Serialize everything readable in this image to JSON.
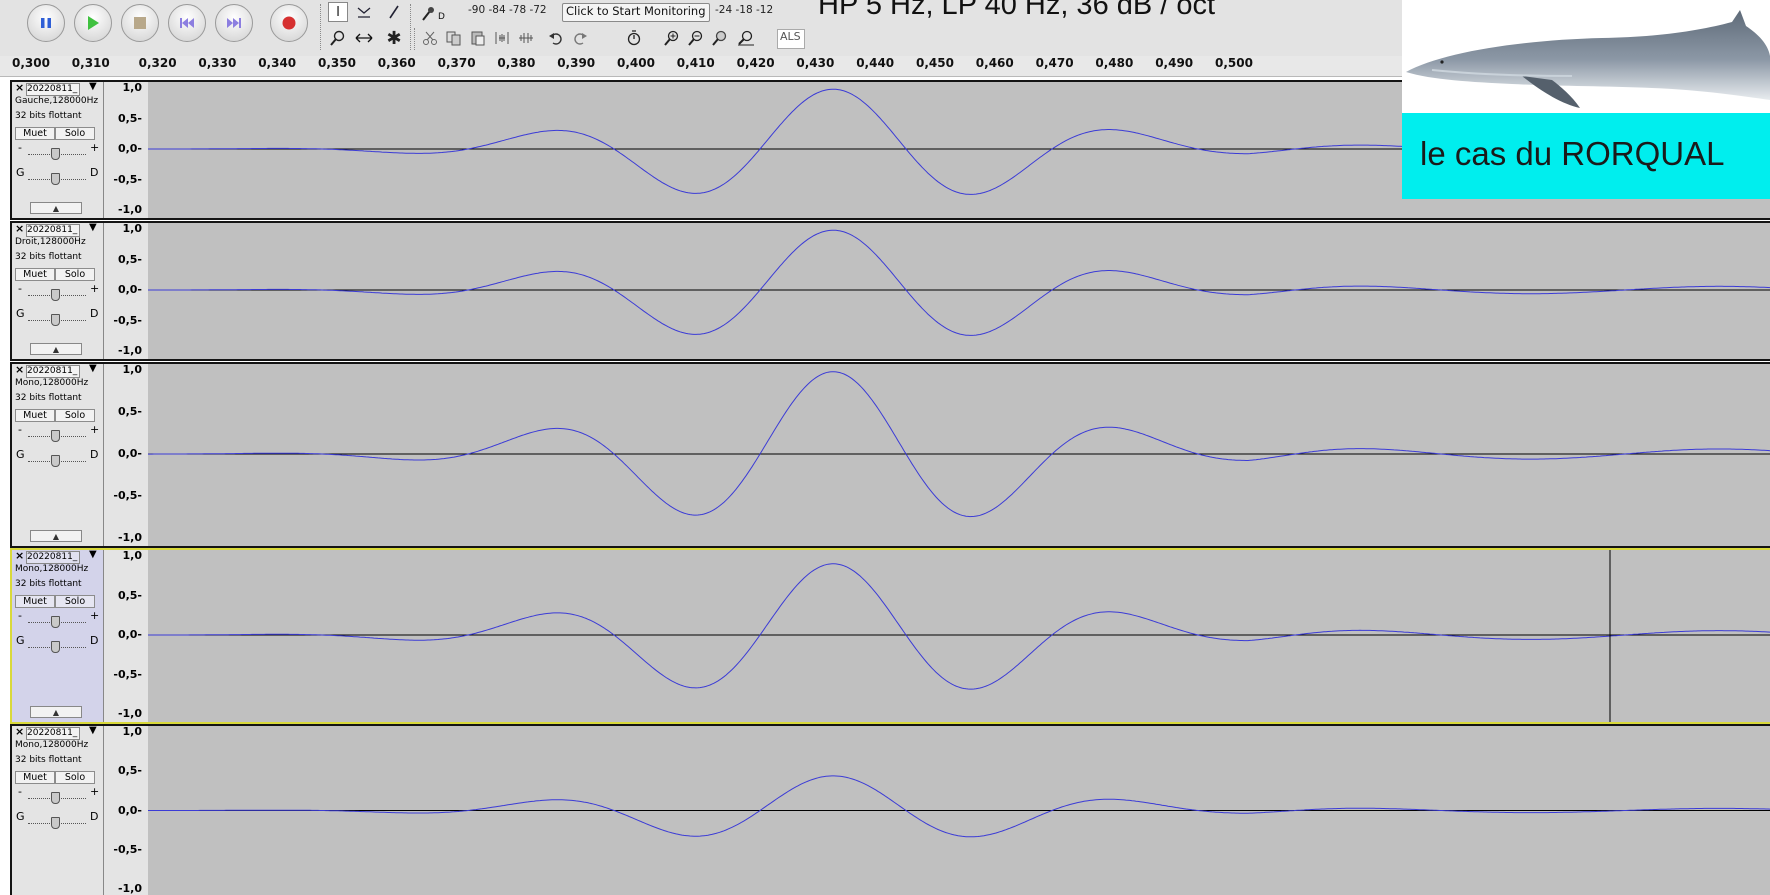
{
  "slide": {
    "title": "HP 5 Hz, LP 40 Hz, 36 dB / oct",
    "caption": "le cas du RORQUAL"
  },
  "toolbar": {
    "buttons": [
      {
        "name": "pause-button",
        "icon": "pause-icon"
      },
      {
        "name": "play-button",
        "icon": "play-icon"
      },
      {
        "name": "stop-button",
        "icon": "stop-icon"
      },
      {
        "name": "skip-start-button",
        "icon": "skip-start-icon"
      },
      {
        "name": "skip-end-button",
        "icon": "skip-end-icon"
      },
      {
        "name": "record-button",
        "icon": "record-icon"
      }
    ],
    "meter_scale_left": "-90 -84 -78 -72",
    "monitor_label": "Click to Start Monitoring",
    "meter_scale_right": "-24 -18 -12",
    "audio_host": "ALS",
    "meter_letter": "D"
  },
  "ruler": {
    "ticks": [
      "0,300",
      "0,310",
      "0,320",
      "0,330",
      "0,340",
      "0,350",
      "0,360",
      "0,370",
      "0,380",
      "0,390",
      "0,400",
      "0,410",
      "0,420",
      "0,430",
      "0,440",
      "0,450",
      "0,460",
      "0,470",
      "0,480",
      "0,490",
      "0,500"
    ]
  },
  "tracks": [
    {
      "name": "20220811_",
      "channel": "Gauche,128000Hz",
      "format": "32 bits flottant",
      "mute": "Muet",
      "solo": "Solo",
      "gain_left": "-",
      "gain_right": "+",
      "pan_left": "G",
      "pan_right": "D",
      "scale": [
        "1,0",
        "0,5-",
        "0,0-",
        "-0,5-",
        "-1,0"
      ],
      "selected": false
    },
    {
      "name": "20220811_",
      "channel": "Droit,128000Hz",
      "format": "32 bits flottant",
      "mute": "Muet",
      "solo": "Solo",
      "gain_left": "-",
      "gain_right": "+",
      "pan_left": "G",
      "pan_right": "D",
      "scale": [
        "1,0",
        "0,5-",
        "0,0-",
        "-0,5-",
        "-1,0"
      ],
      "selected": false
    },
    {
      "name": "20220811_",
      "channel": "Mono,128000Hz",
      "format": "32 bits flottant",
      "mute": "Muet",
      "solo": "Solo",
      "gain_left": "-",
      "gain_right": "+",
      "pan_left": "G",
      "pan_right": "D",
      "scale": [
        "1,0",
        "0,5-",
        "0,0-",
        "-0,5-",
        "-1,0"
      ],
      "selected": false
    },
    {
      "name": "20220811_",
      "channel": "Mono,128000Hz",
      "format": "32 bits flottant",
      "mute": "Muet",
      "solo": "Solo",
      "gain_left": "-",
      "gain_right": "+",
      "pan_left": "G",
      "pan_right": "D",
      "scale": [
        "1,0",
        "0,5-",
        "0,0-",
        "-0,5-",
        "-1,0"
      ],
      "selected": true
    },
    {
      "name": "20220811_",
      "channel": "Mono,128000Hz",
      "format": "32 bits flottant",
      "mute": "Muet",
      "solo": "Solo",
      "gain_left": "-",
      "gain_right": "+",
      "pan_left": "G",
      "pan_right": "D",
      "scale": [
        "1,0",
        "0,5-",
        "0,0-",
        "-0,5-",
        "-1,0"
      ],
      "selected": false
    }
  ],
  "colors": {
    "waveform": "#3b3bd6",
    "wave_bg": "#c0c0c0",
    "caption_bg": "#00eeee",
    "selected_border": "#d9d93a"
  }
}
